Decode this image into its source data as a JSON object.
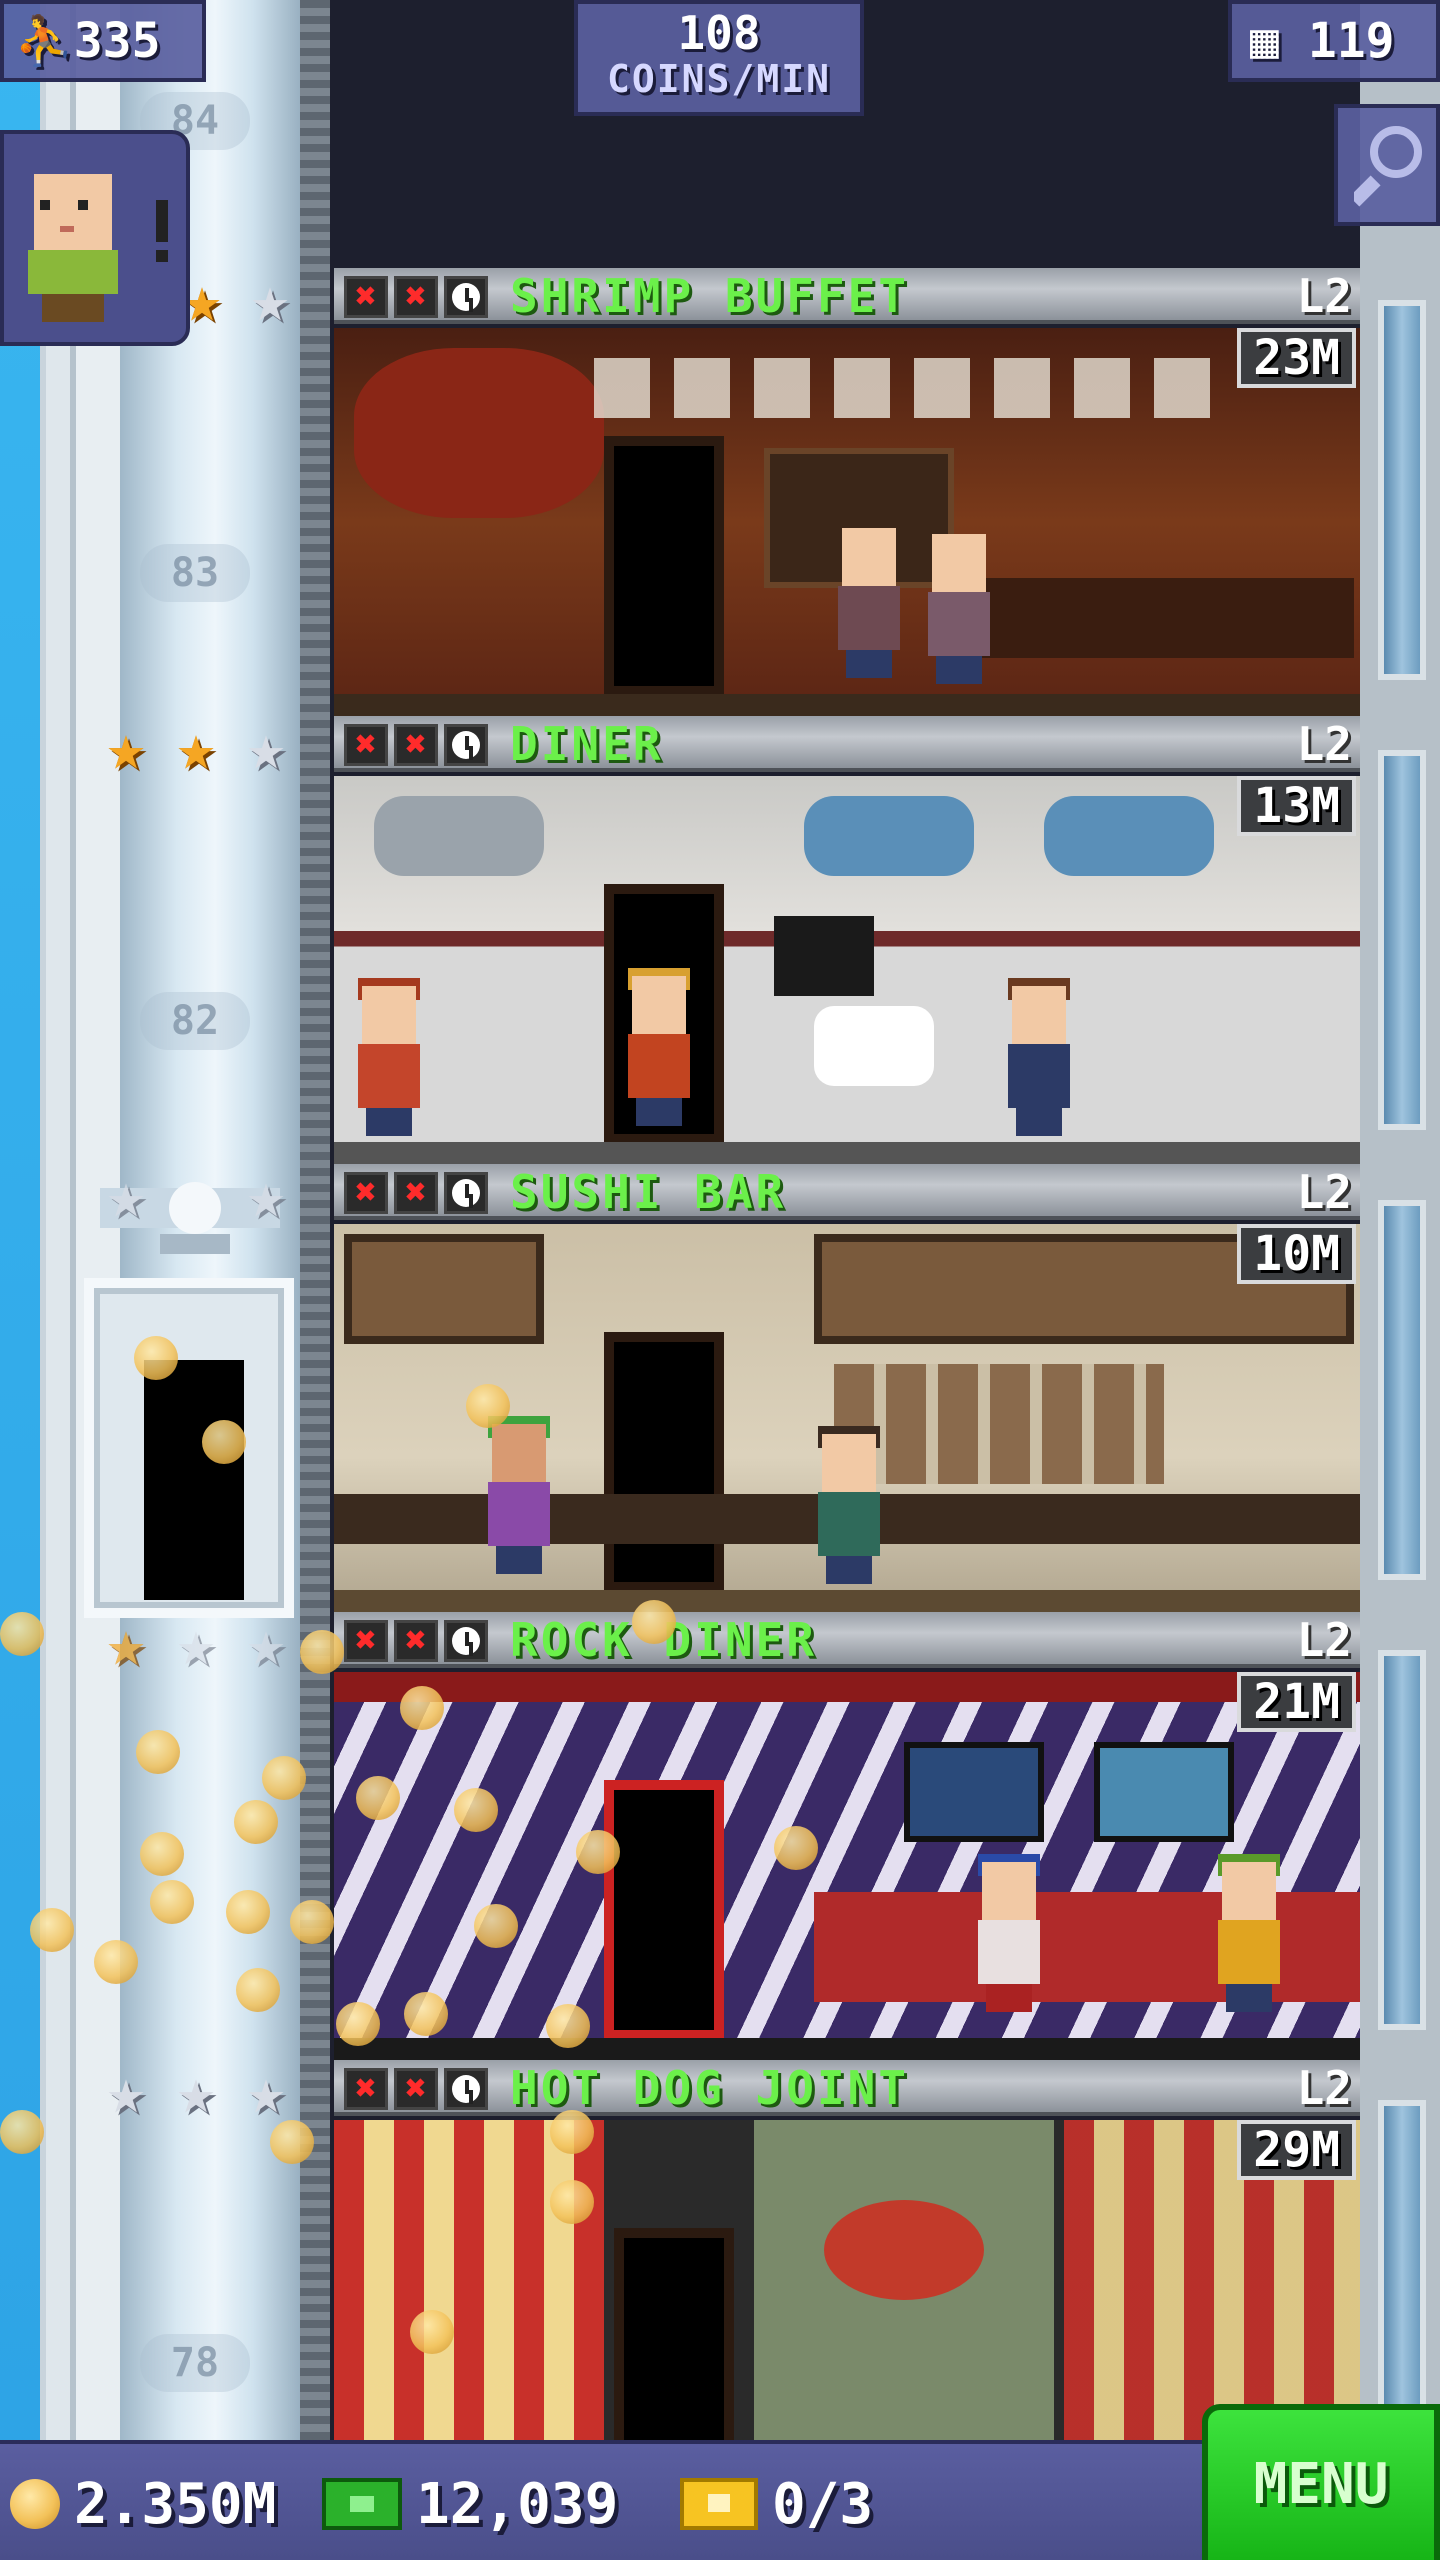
{
  "hud": {
    "population": "335",
    "coins_rate_value": "108",
    "coins_rate_unit": "COINS/MIN",
    "floor_count": "119",
    "search_icon": "magnifier-icon"
  },
  "shaft_floor_numbers": [
    "84",
    "83",
    "82",
    "78"
  ],
  "floors": [
    {
      "name": "SHRIMP BUFFET",
      "level": "L2",
      "value": "23M",
      "stars": [
        "gold",
        "gold",
        "silver"
      ],
      "status": [
        "no-stock-icon",
        "no-stock-icon",
        "clock-icon"
      ]
    },
    {
      "name": "DINER",
      "level": "L2",
      "value": "13M",
      "stars": [
        "gold",
        "gold",
        "silver"
      ],
      "status": [
        "no-stock-icon",
        "no-stock-icon",
        "clock-icon"
      ]
    },
    {
      "name": "SUSHI BAR",
      "level": "L2",
      "value": "10M",
      "stars": [
        "silver",
        "silver",
        "silver"
      ],
      "status": [
        "no-stock-icon",
        "no-stock-icon",
        "clock-icon"
      ]
    },
    {
      "name": "ROCK DINER",
      "level": "L2",
      "value": "21M",
      "stars": [
        "gold",
        "silver",
        "silver"
      ],
      "status": [
        "no-stock-icon",
        "no-stock-icon",
        "clock-icon"
      ]
    },
    {
      "name": "HOT DOG JOINT",
      "level": "L2",
      "value": "29M",
      "stars": [
        "silver",
        "silver",
        "silver"
      ],
      "status": [
        "no-stock-icon",
        "no-stock-icon",
        "clock-icon"
      ]
    }
  ],
  "bottom_bar": {
    "coins": "2.350M",
    "bux": "12,039",
    "tickets": "0/3",
    "menu_label": "MENU"
  },
  "colors": {
    "floor_name": "#6bf04a",
    "hud_panel": "#5a5fa0",
    "menu_button": "#2bd12b",
    "sky": "#39b6f0"
  }
}
